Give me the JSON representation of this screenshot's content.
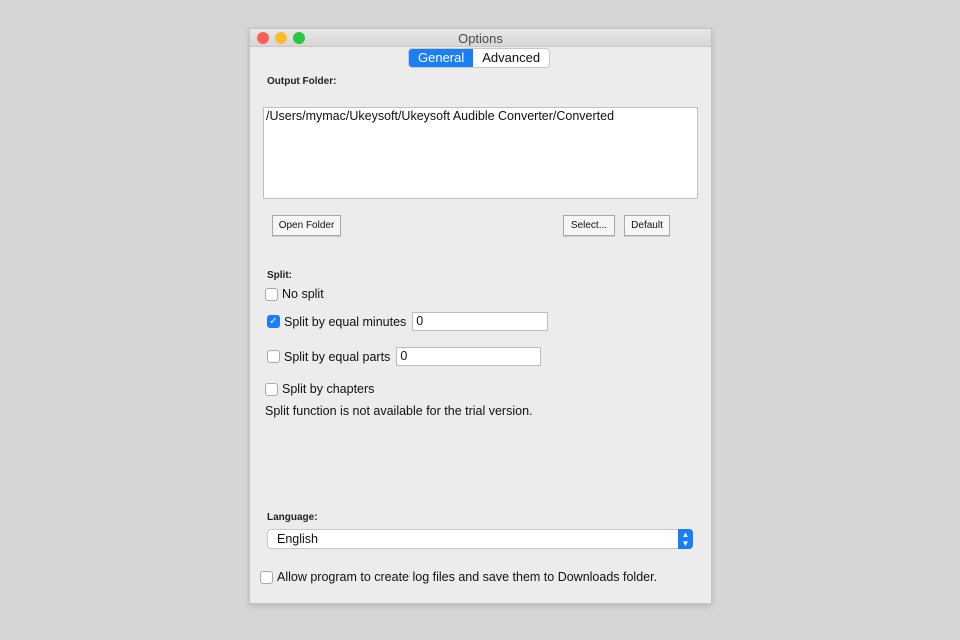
{
  "window": {
    "title": "Options"
  },
  "tabs": [
    {
      "label": "General",
      "active": true
    },
    {
      "label": "Advanced",
      "active": false
    }
  ],
  "output": {
    "label": "Output Folder:",
    "path": "/Users/mymac/Ukeysoft/Ukeysoft Audible Converter/Converted",
    "open_folder": "Open Folder",
    "select": "Select...",
    "default": "Default"
  },
  "split": {
    "label": "Split:",
    "no_split": "No split",
    "by_minutes": "Split by equal minutes",
    "minutes_value": "0",
    "by_parts": "Split by equal parts",
    "parts_value": "0",
    "by_chapters": "Split by chapters",
    "note": "Split function is not available for the trial version."
  },
  "language": {
    "label": "Language:",
    "value": "English"
  },
  "log": {
    "label": "Allow program to create log files and save them to Downloads folder."
  },
  "colors": {
    "accent": "#1a7ff5",
    "close": "#fe5f57",
    "minimize": "#febc2e",
    "zoom": "#28c840"
  }
}
